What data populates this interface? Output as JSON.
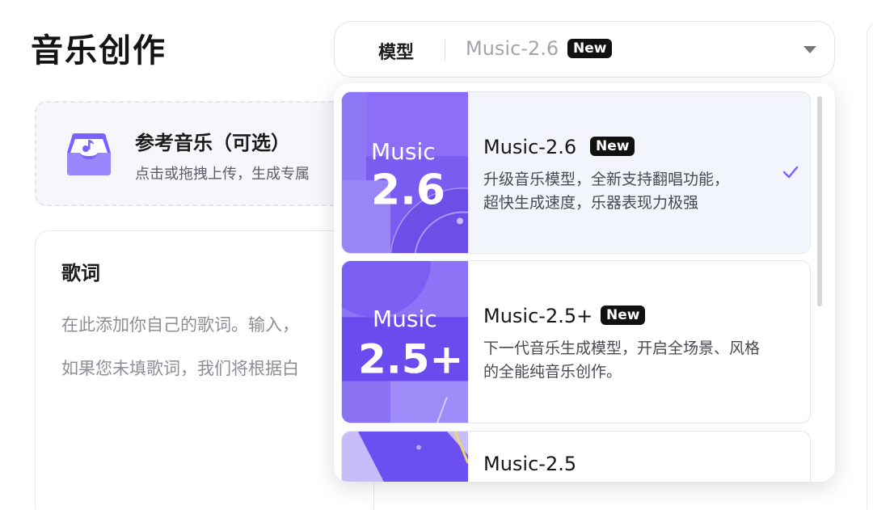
{
  "page": {
    "title": "音乐创作"
  },
  "upload": {
    "title": "参考音乐（可选）",
    "subtitle": "点击或拖拽上传，生成专属"
  },
  "lyrics": {
    "label": "歌词",
    "placeholder_line1": "在此添加你自己的歌词。输入，",
    "placeholder_line2": "如果您未填歌词，我们将根据白"
  },
  "model_select": {
    "label": "模型",
    "value": "Music-2.6",
    "badge": "New"
  },
  "options": [
    {
      "name": "Music-2.6",
      "badge": "New",
      "thumb_top": "Music",
      "thumb_big": "2.6",
      "description_line1": "升级音乐模型，全新支持翻唱功能，",
      "description_line2": "超快生成速度，乐器表现力极强",
      "selected": true
    },
    {
      "name": "Music-2.5+",
      "badge": "New",
      "thumb_top": "Music",
      "thumb_big": "2.5+",
      "description_line1": "下一代音乐生成模型，开启全场景、风格",
      "description_line2": "的全能纯音乐创作。",
      "selected": false
    },
    {
      "name": "Music-2.5",
      "selected": false
    }
  ],
  "colors": {
    "accent": "#7b61ff",
    "badge_bg": "#111111",
    "selected_bg": "#f2f5fb"
  },
  "icons": {
    "upload": "music-inbox-icon",
    "check": "check-icon",
    "caret": "chevron-down-icon"
  }
}
